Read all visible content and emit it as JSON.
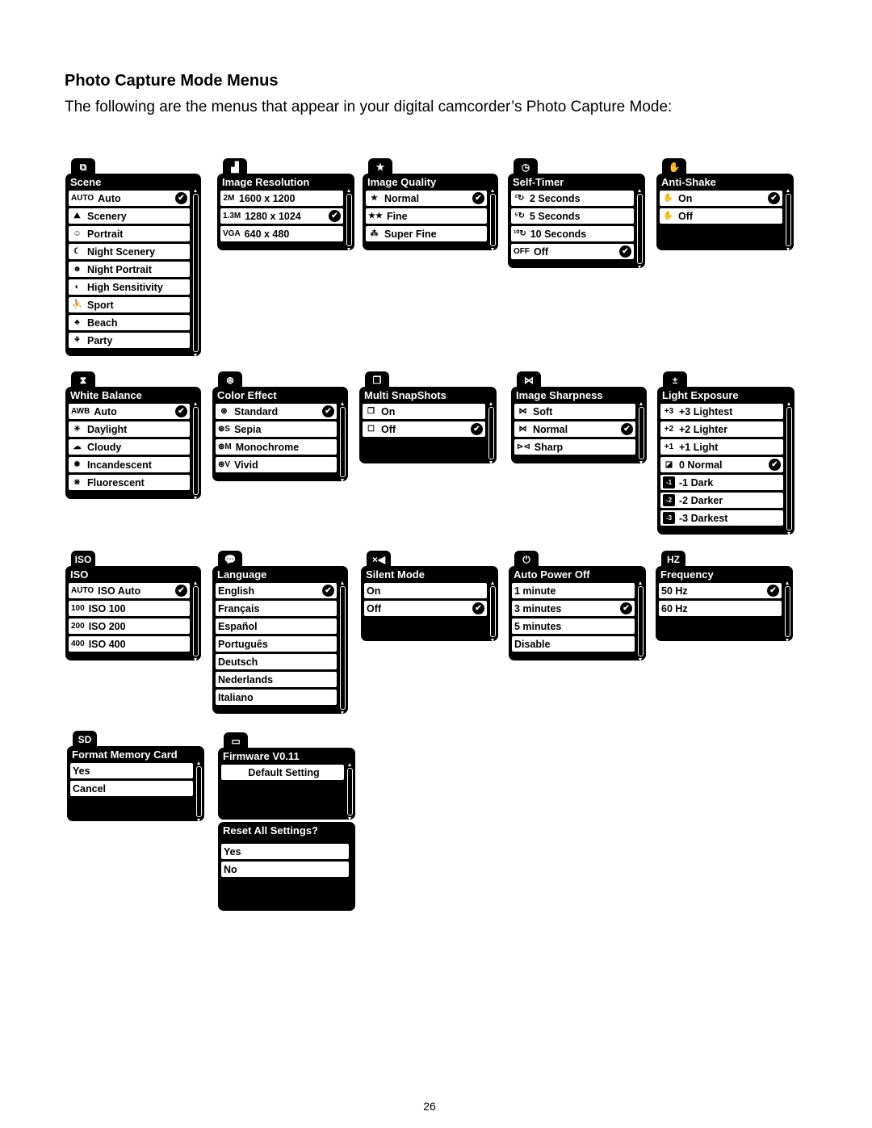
{
  "heading": "Photo Capture Mode Menus",
  "intro": "The following are the menus that appear in your digital camcorder’s Photo Capture Mode:",
  "page_number": "26",
  "menus": {
    "scene": {
      "tab_icon": "⧉",
      "title": "Scene",
      "items": [
        {
          "icon": "AUTO",
          "label": "Auto",
          "selected": true
        },
        {
          "icon": "⛰",
          "label": "Scenery"
        },
        {
          "icon": "☺",
          "label": "Portrait"
        },
        {
          "icon": "☾",
          "label": "Night Scenery"
        },
        {
          "icon": "☻",
          "label": "Night Portrait"
        },
        {
          "icon": "◐",
          "label": "High Sensitivity"
        },
        {
          "icon": "⛹",
          "label": "Sport"
        },
        {
          "icon": "♣",
          "label": "Beach"
        },
        {
          "icon": "⚘",
          "label": "Party"
        }
      ]
    },
    "image_resolution": {
      "tab_icon": "▟",
      "title": "Image Resolution",
      "items": [
        {
          "icon": "2M",
          "label": "1600 x 1200"
        },
        {
          "icon": "1.3M",
          "label": "1280 x 1024",
          "selected": true
        },
        {
          "icon": "VGA",
          "label": "640 x 480"
        }
      ]
    },
    "image_quality": {
      "tab_icon": "★",
      "title": "Image Quality",
      "items": [
        {
          "icon": "★",
          "label": "Normal",
          "selected": true
        },
        {
          "icon": "★★",
          "label": "Fine"
        },
        {
          "icon": "⁂",
          "label": "Super Fine"
        }
      ]
    },
    "self_timer": {
      "tab_icon": "◷",
      "title": "Self-Timer",
      "items": [
        {
          "icon": "²↻",
          "label": "2 Seconds"
        },
        {
          "icon": "⁵↻",
          "label": "5 Seconds"
        },
        {
          "icon": "¹⁰↻",
          "label": "10 Seconds"
        },
        {
          "icon": "OFF",
          "label": "Off",
          "selected": true
        }
      ]
    },
    "anti_shake": {
      "tab_icon": "✋",
      "title": "Anti-Shake",
      "items": [
        {
          "icon": "✋",
          "label": "On",
          "selected": true
        },
        {
          "icon": "✋",
          "label": "Off"
        }
      ]
    },
    "white_balance": {
      "tab_icon": "⧗",
      "title": "White Balance",
      "items": [
        {
          "icon": "AWB",
          "label": "Auto",
          "selected": true
        },
        {
          "icon": "☀",
          "label": "Daylight"
        },
        {
          "icon": "☁",
          "label": "Cloudy"
        },
        {
          "icon": "✹",
          "label": "Incandescent"
        },
        {
          "icon": "⋇",
          "label": "Fluorescent"
        }
      ]
    },
    "color_effect": {
      "tab_icon": "⊛",
      "title": "Color Effect",
      "items": [
        {
          "icon": "⊛",
          "label": "Standard",
          "selected": true
        },
        {
          "icon": "⊛S",
          "label": "Sepia"
        },
        {
          "icon": "⊛M",
          "label": "Monochrome"
        },
        {
          "icon": "⊛V",
          "label": "Vivid"
        }
      ]
    },
    "multi_snapshots": {
      "tab_icon": "❐",
      "title": "Multi SnapShots",
      "items": [
        {
          "icon": "❐",
          "label": "On"
        },
        {
          "icon": "☐",
          "label": "Off",
          "selected": true
        }
      ]
    },
    "image_sharpness": {
      "tab_icon": "⋈",
      "title": "Image Sharpness",
      "items": [
        {
          "icon": "⋈",
          "label": "Soft"
        },
        {
          "icon": "⋈",
          "label": "Normal",
          "selected": true
        },
        {
          "icon": "⊳⊲",
          "label": "Sharp"
        }
      ]
    },
    "light_exposure": {
      "tab_icon": "±",
      "title": "Light Exposure",
      "items": [
        {
          "icon": "+3",
          "label": "+3 Lightest"
        },
        {
          "icon": "+2",
          "label": "+2 Lighter"
        },
        {
          "icon": "+1",
          "label": "+1 Light"
        },
        {
          "icon": "◪",
          "label": "0 Normal",
          "selected": true
        },
        {
          "icon": "-1",
          "label": "-1 Dark",
          "dark": true
        },
        {
          "icon": "-2",
          "label": "-2 Darker",
          "dark": true
        },
        {
          "icon": "-3",
          "label": "-3 Darkest",
          "dark": true
        }
      ]
    },
    "iso": {
      "tab_icon": "ISO",
      "title": "ISO",
      "items": [
        {
          "icon": "AUTO",
          "label": "ISO Auto",
          "selected": true
        },
        {
          "icon": "100",
          "label": "ISO 100"
        },
        {
          "icon": "200",
          "label": "ISO 200"
        },
        {
          "icon": "400",
          "label": "ISO 400"
        }
      ]
    },
    "language": {
      "tab_icon": "💬",
      "title": "Language",
      "items": [
        {
          "label": "English",
          "selected": true
        },
        {
          "label": "Français"
        },
        {
          "label": "Español"
        },
        {
          "label": "Português"
        },
        {
          "label": "Deutsch"
        },
        {
          "label": "Nederlands"
        },
        {
          "label": "Italiano"
        }
      ]
    },
    "silent_mode": {
      "tab_icon": "×◀",
      "title": "Silent Mode",
      "items": [
        {
          "label": "On"
        },
        {
          "label": "Off",
          "selected": true
        }
      ]
    },
    "auto_power_off": {
      "tab_icon": "⏻",
      "title": "Auto Power Off",
      "items": [
        {
          "label": "1 minute"
        },
        {
          "label": "3 minutes",
          "selected": true
        },
        {
          "label": "5 minutes"
        },
        {
          "label": "Disable"
        }
      ]
    },
    "frequency": {
      "tab_icon": "HZ",
      "title": "Frequency",
      "items": [
        {
          "label": "50 Hz",
          "selected": true
        },
        {
          "label": "60 Hz"
        }
      ]
    },
    "format_memory_card": {
      "tab_icon": "SD",
      "title": "Format Memory Card",
      "items": [
        {
          "label": "Yes"
        },
        {
          "label": "Cancel"
        }
      ]
    },
    "firmware": {
      "tab_icon": "▭",
      "title": "Firmware V0.11",
      "items": [
        {
          "label": "Default Setting",
          "center": true
        }
      ]
    },
    "reset_all": {
      "title": "Reset All Settings?",
      "items": [
        {
          "label": "Yes"
        },
        {
          "label": "No"
        }
      ]
    }
  }
}
